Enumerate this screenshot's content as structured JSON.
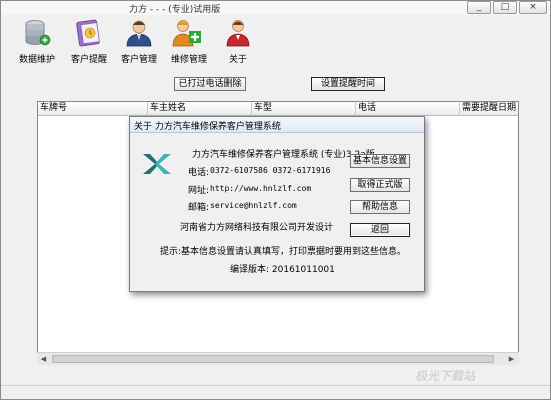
{
  "window": {
    "title": "力方 - - - (专业)试用版",
    "minimize": "_",
    "maximize": "□",
    "close": "×"
  },
  "toolbar": {
    "items": [
      {
        "label": "数据维护",
        "icon": "database-icon"
      },
      {
        "label": "客户提醒",
        "icon": "reminder-icon"
      },
      {
        "label": "客户管理",
        "icon": "customer-icon"
      },
      {
        "label": "维修管理",
        "icon": "repair-add-icon"
      },
      {
        "label": "关于",
        "icon": "about-icon"
      }
    ]
  },
  "actions": {
    "called_delete": "已打过电话删除",
    "set_reminder_time": "设置提醒时间"
  },
  "grid": {
    "columns": [
      "车牌号",
      "车主姓名",
      "车型",
      "电话",
      "需要提醒日期"
    ]
  },
  "dialog": {
    "title": "关于 力方汽车维修保养客户管理系统",
    "product_name": "力方汽车维修保养客户管理系统 (专业)3.2a版",
    "phone_label": "电话:",
    "phone_value": "0372-6107586  0372-6171916",
    "website_label": "网址:",
    "website_value": "http://www.hnlzlf.com",
    "email_label": "邮箱:",
    "email_value": "service@hnlzlf.com",
    "developer": "河南省力方网络科技有限公司开发设计",
    "hint": "提示:基本信息设置请认真填写，打印票据时要用到这些信息。",
    "version": "编译版本: 20161011001",
    "buttons": {
      "basic_info": "基本信息设置",
      "get_license": "取得正式版",
      "help": "帮助信息",
      "back": "返回"
    }
  },
  "watermark": "极光下载站",
  "colors": {
    "logo_dark": "#1f6f79",
    "logo_light": "#3fb2b7",
    "accent_green": "#2fa83a"
  }
}
